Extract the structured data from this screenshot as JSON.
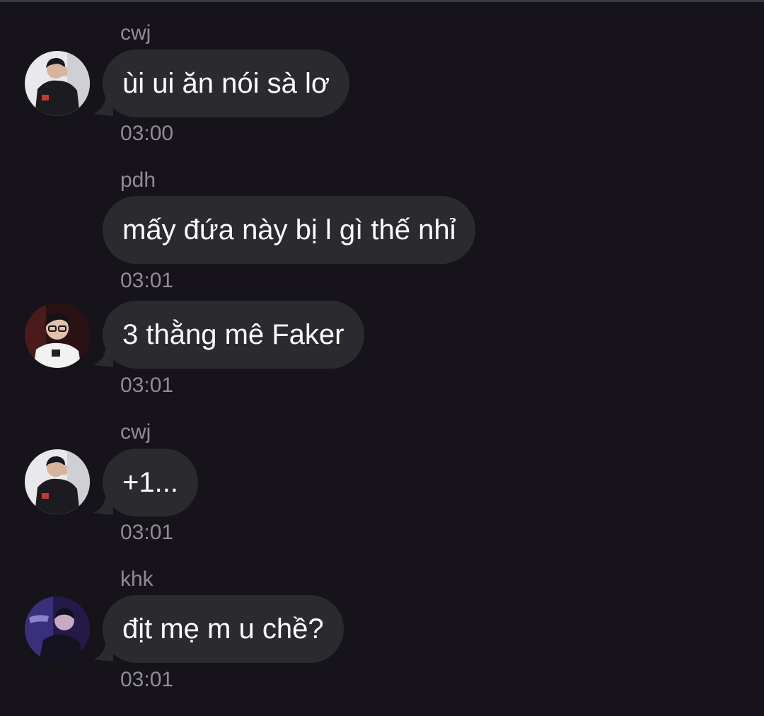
{
  "conversation": {
    "messages": [
      {
        "sender": "cwj",
        "text": "ùi ui ăn nói sà lơ",
        "time": "03:00",
        "avatar_icon": "user-photo-icon"
      },
      {
        "sender": "pdh",
        "text": "mấy đứa này bị l gì thế nhỉ",
        "time": "03:01"
      },
      {
        "sender": "",
        "text": "3 thằng mê Faker",
        "time": "03:01",
        "avatar_icon": "user-photo-icon"
      },
      {
        "sender": "cwj",
        "text": "+1...",
        "time": "03:01",
        "avatar_icon": "user-photo-icon"
      },
      {
        "sender": "khk",
        "text": "địt mẹ m u chề?",
        "time": "03:01",
        "avatar_icon": "user-photo-icon"
      }
    ]
  },
  "colors": {
    "background": "#16131a",
    "bubble": "#2b2a2f",
    "message_text": "#ffffff",
    "meta_text": "#8f8c95"
  }
}
